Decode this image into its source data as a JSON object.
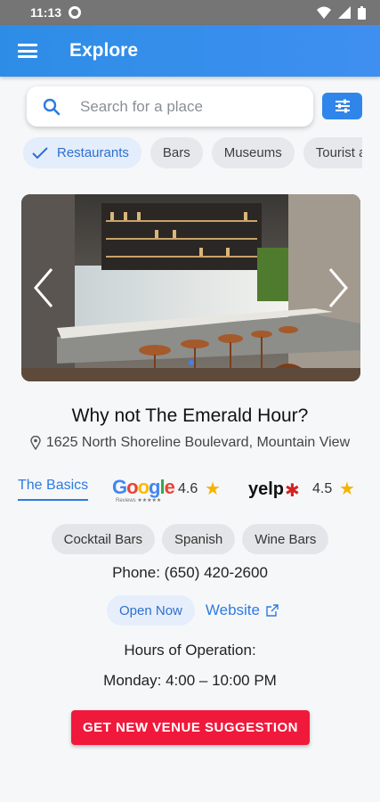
{
  "status_bar": {
    "time": "11:13"
  },
  "app_bar": {
    "title": "Explore",
    "menu_icon": "menu-icon"
  },
  "search": {
    "placeholder": "Search for a place",
    "icon": "search-icon"
  },
  "filter_button": {
    "icon": "tune-icon",
    "color": "#2f85ea"
  },
  "categories": [
    {
      "label": "Restaurants",
      "selected": true
    },
    {
      "label": "Bars",
      "selected": false
    },
    {
      "label": "Museums",
      "selected": false
    },
    {
      "label": "Tourist a",
      "selected": false
    }
  ],
  "carousel": {
    "image": "restaurant-bar-interior-photo",
    "page_indicator": "1"
  },
  "venue": {
    "title": "Why not The Emerald Hour?",
    "address": "1625 North Shoreline Boulevard, Mountain View"
  },
  "tabs": {
    "basics": "The Basics"
  },
  "ratings": {
    "google_logo": "Google",
    "google_sub": "Reviews ★★★★★",
    "google_rating": "4.6",
    "yelp_logo": "yelp",
    "yelp_rating": "4.5"
  },
  "tags": [
    "Cocktail Bars",
    "Spanish",
    "Wine Bars"
  ],
  "phone": "Phone: (650) 420-2600",
  "open_status": "Open Now",
  "website_label": "Website",
  "hours": {
    "title": "Hours of Operation:",
    "today": "Monday: 4:00 – 10:00 PM"
  },
  "cta_label": "GET NEW VENUE SUGGESTION",
  "colors": {
    "primary": "#2d8de6",
    "cta": "#f0193b",
    "star": "#f4b400"
  }
}
